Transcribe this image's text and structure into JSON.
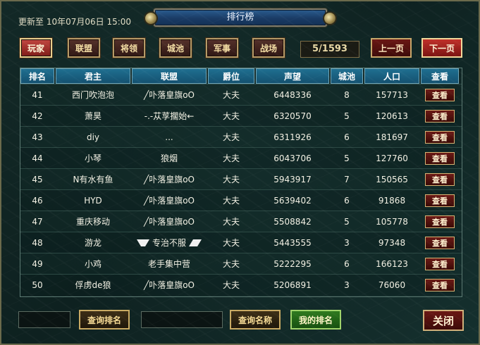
{
  "header": {
    "updated_text": "更新至 10年07月06日 15:00",
    "title": "排行榜"
  },
  "tabs": [
    {
      "label": "玩家",
      "active": true
    },
    {
      "label": "联盟",
      "active": false
    },
    {
      "label": "将领",
      "active": false
    },
    {
      "label": "城池",
      "active": false
    },
    {
      "label": "军事",
      "active": false
    },
    {
      "label": "战场",
      "active": false
    }
  ],
  "pagination": {
    "indicator": "5/1593",
    "prev_label": "上一页",
    "next_label": "下一页"
  },
  "table": {
    "columns": [
      "排名",
      "君主",
      "联盟",
      "爵位",
      "声望",
      "城池",
      "人口",
      "查看"
    ],
    "rows": [
      {
        "rank": "41",
        "lord": "西门吹泡泡",
        "alliance": "╱卟落皇旗oO",
        "title": "大夫",
        "prestige": "6448336",
        "cities": "8",
        "population": "157713",
        "view": "查看"
      },
      {
        "rank": "42",
        "lord": "萧昊",
        "alliance": "-.-苁莩擱始←",
        "title": "大夫",
        "prestige": "6320570",
        "cities": "5",
        "population": "120613",
        "view": "查看"
      },
      {
        "rank": "43",
        "lord": "diy",
        "alliance": "...",
        "title": "大夫",
        "prestige": "6311926",
        "cities": "6",
        "population": "181697",
        "view": "查看"
      },
      {
        "rank": "44",
        "lord": "小琴",
        "alliance": "狼烟",
        "title": "大夫",
        "prestige": "6043706",
        "cities": "5",
        "population": "127760",
        "view": "查看"
      },
      {
        "rank": "45",
        "lord": "N有水有鱼",
        "alliance": "╱卟落皇旗oO",
        "title": "大夫",
        "prestige": "5943917",
        "cities": "7",
        "population": "150565",
        "view": "查看"
      },
      {
        "rank": "46",
        "lord": "HYD",
        "alliance": "╱卟落皇旗oO",
        "title": "大夫",
        "prestige": "5639402",
        "cities": "6",
        "population": "91868",
        "view": "查看"
      },
      {
        "rank": "47",
        "lord": "重庆移动",
        "alliance": "╱卟落皇旗oO",
        "title": "大夫",
        "prestige": "5508842",
        "cities": "5",
        "population": "105778",
        "view": "查看"
      },
      {
        "rank": "48",
        "lord": "游龙",
        "alliance": "专治不服",
        "title": "大夫",
        "prestige": "5443555",
        "cities": "3",
        "population": "97348",
        "view": "查看"
      },
      {
        "rank": "49",
        "lord": "小鸡",
        "alliance": "老手集中营",
        "title": "大夫",
        "prestige": "5222295",
        "cities": "6",
        "population": "166123",
        "view": "查看"
      },
      {
        "rank": "50",
        "lord": "俘虏de狼",
        "alliance": "╱卟落皇旗oO",
        "title": "大夫",
        "prestige": "5206891",
        "cities": "3",
        "population": "76060",
        "view": "查看"
      }
    ]
  },
  "footer": {
    "rank_input_value": "",
    "query_rank_label": "查询排名",
    "name_input_value": "",
    "query_name_label": "查询名称",
    "my_rank_label": "我的排名",
    "close_label": "关闭"
  }
}
